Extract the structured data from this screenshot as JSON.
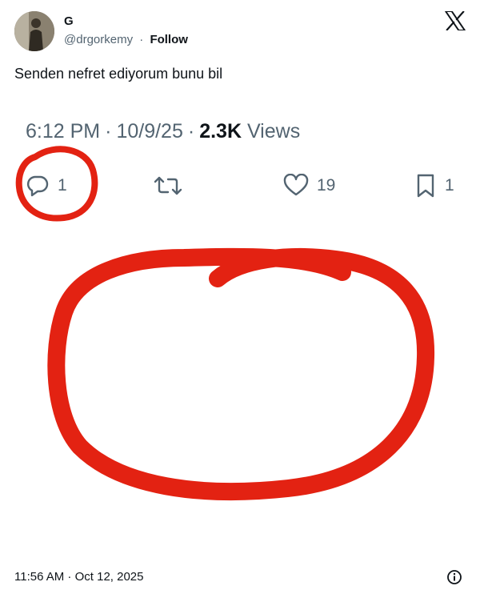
{
  "author": {
    "name": "G",
    "handle": "@drgorkemy",
    "separator": "·",
    "follow_label": "Follow",
    "avatar_icon": "user-avatar-photo"
  },
  "brand_icon": "x-logo-icon",
  "tweet": {
    "text": "Senden nefret ediyorum bunu bil"
  },
  "embedded_screenshot": {
    "time": "6:12 PM",
    "date": "10/9/25",
    "views_count": "2.3K",
    "views_label": "Views",
    "separator": "·",
    "actions": {
      "reply": {
        "icon": "reply-bubble-icon",
        "count": "1"
      },
      "retweet": {
        "icon": "retweet-icon",
        "count": ""
      },
      "like": {
        "icon": "heart-icon",
        "count": "19"
      },
      "bookmark": {
        "icon": "bookmark-icon",
        "count": "1"
      }
    },
    "annotation_color": "#e32212"
  },
  "footer": {
    "timestamp": "11:56 AM · Oct 12, 2025",
    "info_icon": "info-icon"
  },
  "colors": {
    "text_primary": "#0f1419",
    "text_secondary": "#536471",
    "background": "#ffffff",
    "annotation_red": "#e32212"
  }
}
